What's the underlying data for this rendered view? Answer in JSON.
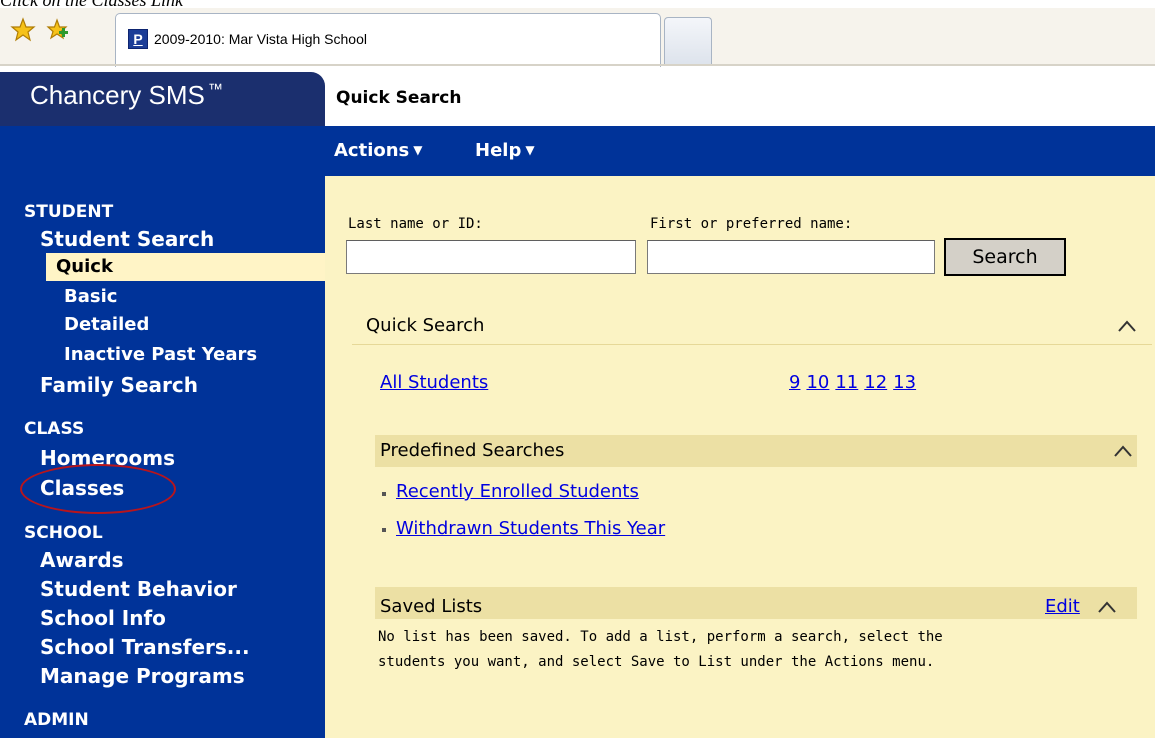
{
  "caption": "Click on the Classes Link",
  "browser": {
    "tab_title": "2009-2010: Mar Vista High School",
    "tab_favicon": "P",
    "toolbar_icons": [
      "favorites-star-icon",
      "add-favorites-icon"
    ]
  },
  "header": {
    "logo": "Chancery SMS",
    "logo_tm": "™",
    "page_title": "Quick Search",
    "menu": [
      {
        "label": "Actions",
        "caret": "▼"
      },
      {
        "label": "Help",
        "caret": "▼"
      }
    ]
  },
  "sidebar": {
    "student": {
      "heading": "STUDENT",
      "student_search": "Student Search",
      "quick": "Quick",
      "basic": "Basic",
      "detailed": "Detailed",
      "inactive": "Inactive Past Years",
      "family_search": "Family Search"
    },
    "class": {
      "heading": "CLASS",
      "homerooms": "Homerooms",
      "classes": "Classes"
    },
    "school": {
      "heading": "SCHOOL",
      "awards": "Awards",
      "student_behavior": "Student Behavior",
      "school_info": "School Info",
      "school_transfers": "School Transfers...",
      "manage_programs": "Manage Programs"
    },
    "admin": {
      "heading": "ADMIN"
    },
    "annotation_color": "#b8151c"
  },
  "search_form": {
    "last_name_label": "Last name or ID:",
    "first_name_label": "First or preferred name:",
    "last_name_value": "",
    "first_name_value": "",
    "search_button": "Search"
  },
  "quick_search_panel": {
    "title": "Quick Search",
    "all_students": "All Students",
    "grades": [
      "9",
      "10",
      "11",
      "12",
      "13"
    ]
  },
  "predefined_panel": {
    "title": "Predefined Searches",
    "items": [
      "Recently Enrolled Students",
      "Withdrawn Students This Year"
    ]
  },
  "saved_lists_panel": {
    "title": "Saved Lists",
    "edit": "Edit",
    "message_line1": "No list has been saved. To add a list, perform a search, select the",
    "message_line2": "students you want, and select Save to List under the Actions menu."
  },
  "colors": {
    "nav_blue": "#003399",
    "logo_navy": "#1b2f6e",
    "content_bg": "#fbf3c4",
    "subheader_bg": "#ece0a4",
    "link_blue": "#0000e0"
  }
}
